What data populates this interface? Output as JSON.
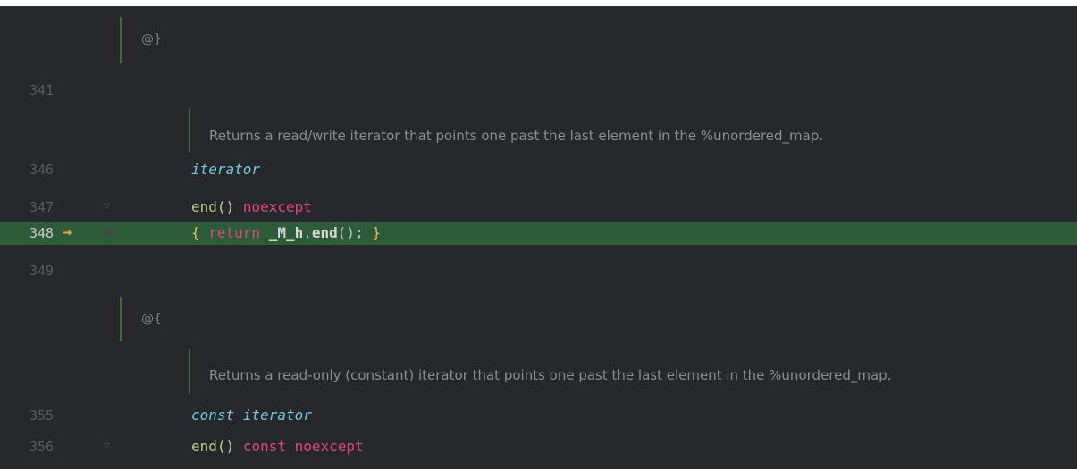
{
  "doc_group_close": {
    "text": "@}"
  },
  "lines": {
    "l341": {
      "num": "341"
    },
    "doc1": {
      "text": "Returns a read/write iterator that points one past the last element in the %unordered_map."
    },
    "l346": {
      "num": "346",
      "code": "iterator"
    },
    "l347": {
      "num": "347",
      "fn": "end()",
      "kw": "noexcept"
    },
    "l348": {
      "num": "348",
      "arrow": "→",
      "brace_open": "{",
      "kw": "return",
      "obj": "_M_h",
      "dot": ".",
      "fn": "end",
      "tail": "();",
      "brace_close": "}"
    },
    "l349": {
      "num": "349"
    },
    "doc_group_open": {
      "text": "@{"
    },
    "doc2": {
      "text": "Returns a read-only (constant) iterator that points one past the last element in the %unordered_map."
    },
    "l355": {
      "num": "355",
      "code": "const_iterator"
    },
    "l356": {
      "num": "356",
      "fn": "end()",
      "kw1": "const",
      "kw2": "noexcept"
    }
  },
  "execution_state": {
    "current_line": "348",
    "highlight_color": "#2e5c3a",
    "arrow_color": "#f0a732"
  },
  "colors": {
    "background": "#27282b",
    "keyword": "#e0467a",
    "type_italic": "#73c9dd",
    "function": "#c7c98f",
    "doc_text": "#8b8d91",
    "doc_bar": "#3f6b3a"
  }
}
